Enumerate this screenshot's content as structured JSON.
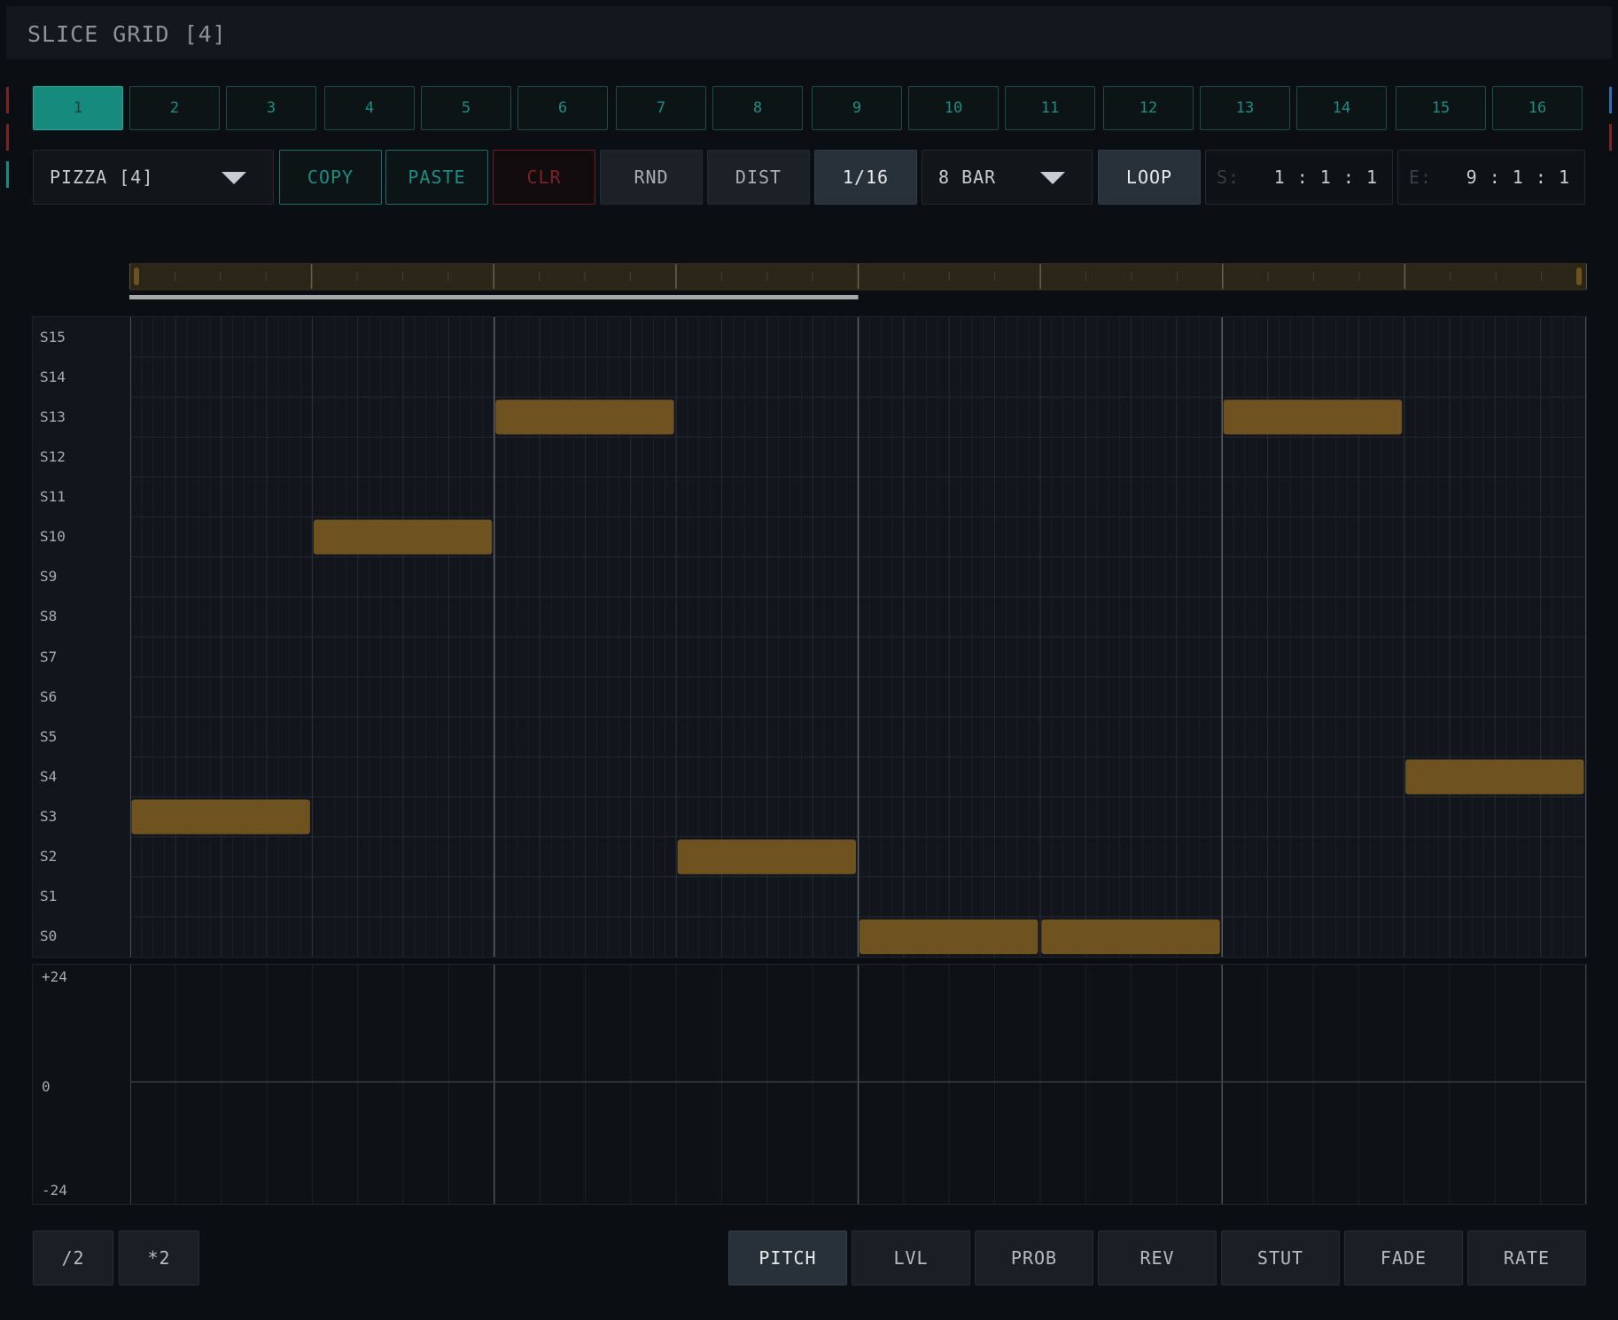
{
  "window": {
    "title": "SLICE GRID [4]"
  },
  "colors": {
    "accent": "#168a7d",
    "note": "#6e5220",
    "danger": "#7a2426",
    "background": "#0b0e12"
  },
  "patterns": {
    "items": [
      "1",
      "2",
      "3",
      "4",
      "5",
      "6",
      "7",
      "8",
      "9",
      "10",
      "11",
      "12",
      "13",
      "14",
      "15",
      "16"
    ],
    "active": "1"
  },
  "toolbar": {
    "sample": "PIZZA [4]",
    "copy": "COPY",
    "paste": "PASTE",
    "clear": "CLR",
    "random": "RND",
    "distribute": "DIST",
    "grid_division": "1/16",
    "length": "8 BAR",
    "loop": "LOOP",
    "start_prefix": "S:",
    "start_value": "1 : 1 : 1",
    "end_prefix": "E:",
    "end_value": "9 : 1 : 1"
  },
  "timeline": {
    "bars": 8,
    "playhead_end_bar": 4
  },
  "grid": {
    "rows": [
      "S15",
      "S14",
      "S13",
      "S12",
      "S11",
      "S10",
      "S9",
      "S8",
      "S7",
      "S6",
      "S5",
      "S4",
      "S3",
      "S2",
      "S1",
      "S0"
    ],
    "steps_per_bar": 16,
    "total_bars": 8,
    "notes": [
      {
        "slice": "S3",
        "start_step": 0,
        "length_steps": 16
      },
      {
        "slice": "S10",
        "start_step": 16,
        "length_steps": 16
      },
      {
        "slice": "S13",
        "start_step": 32,
        "length_steps": 16
      },
      {
        "slice": "S2",
        "start_step": 48,
        "length_steps": 16
      },
      {
        "slice": "S0",
        "start_step": 64,
        "length_steps": 16
      },
      {
        "slice": "S0",
        "start_step": 80,
        "length_steps": 16
      },
      {
        "slice": "S13",
        "start_step": 96,
        "length_steps": 16
      },
      {
        "slice": "S4",
        "start_step": 112,
        "length_steps": 16
      }
    ]
  },
  "envelope": {
    "max_label": "+24",
    "mid_label": "0",
    "min_label": "-24"
  },
  "bottom": {
    "halve": "/2",
    "double": "*2",
    "lanes": [
      "PITCH",
      "LVL",
      "PROB",
      "REV",
      "STUT",
      "FADE",
      "RATE"
    ],
    "active_lane": "PITCH"
  }
}
